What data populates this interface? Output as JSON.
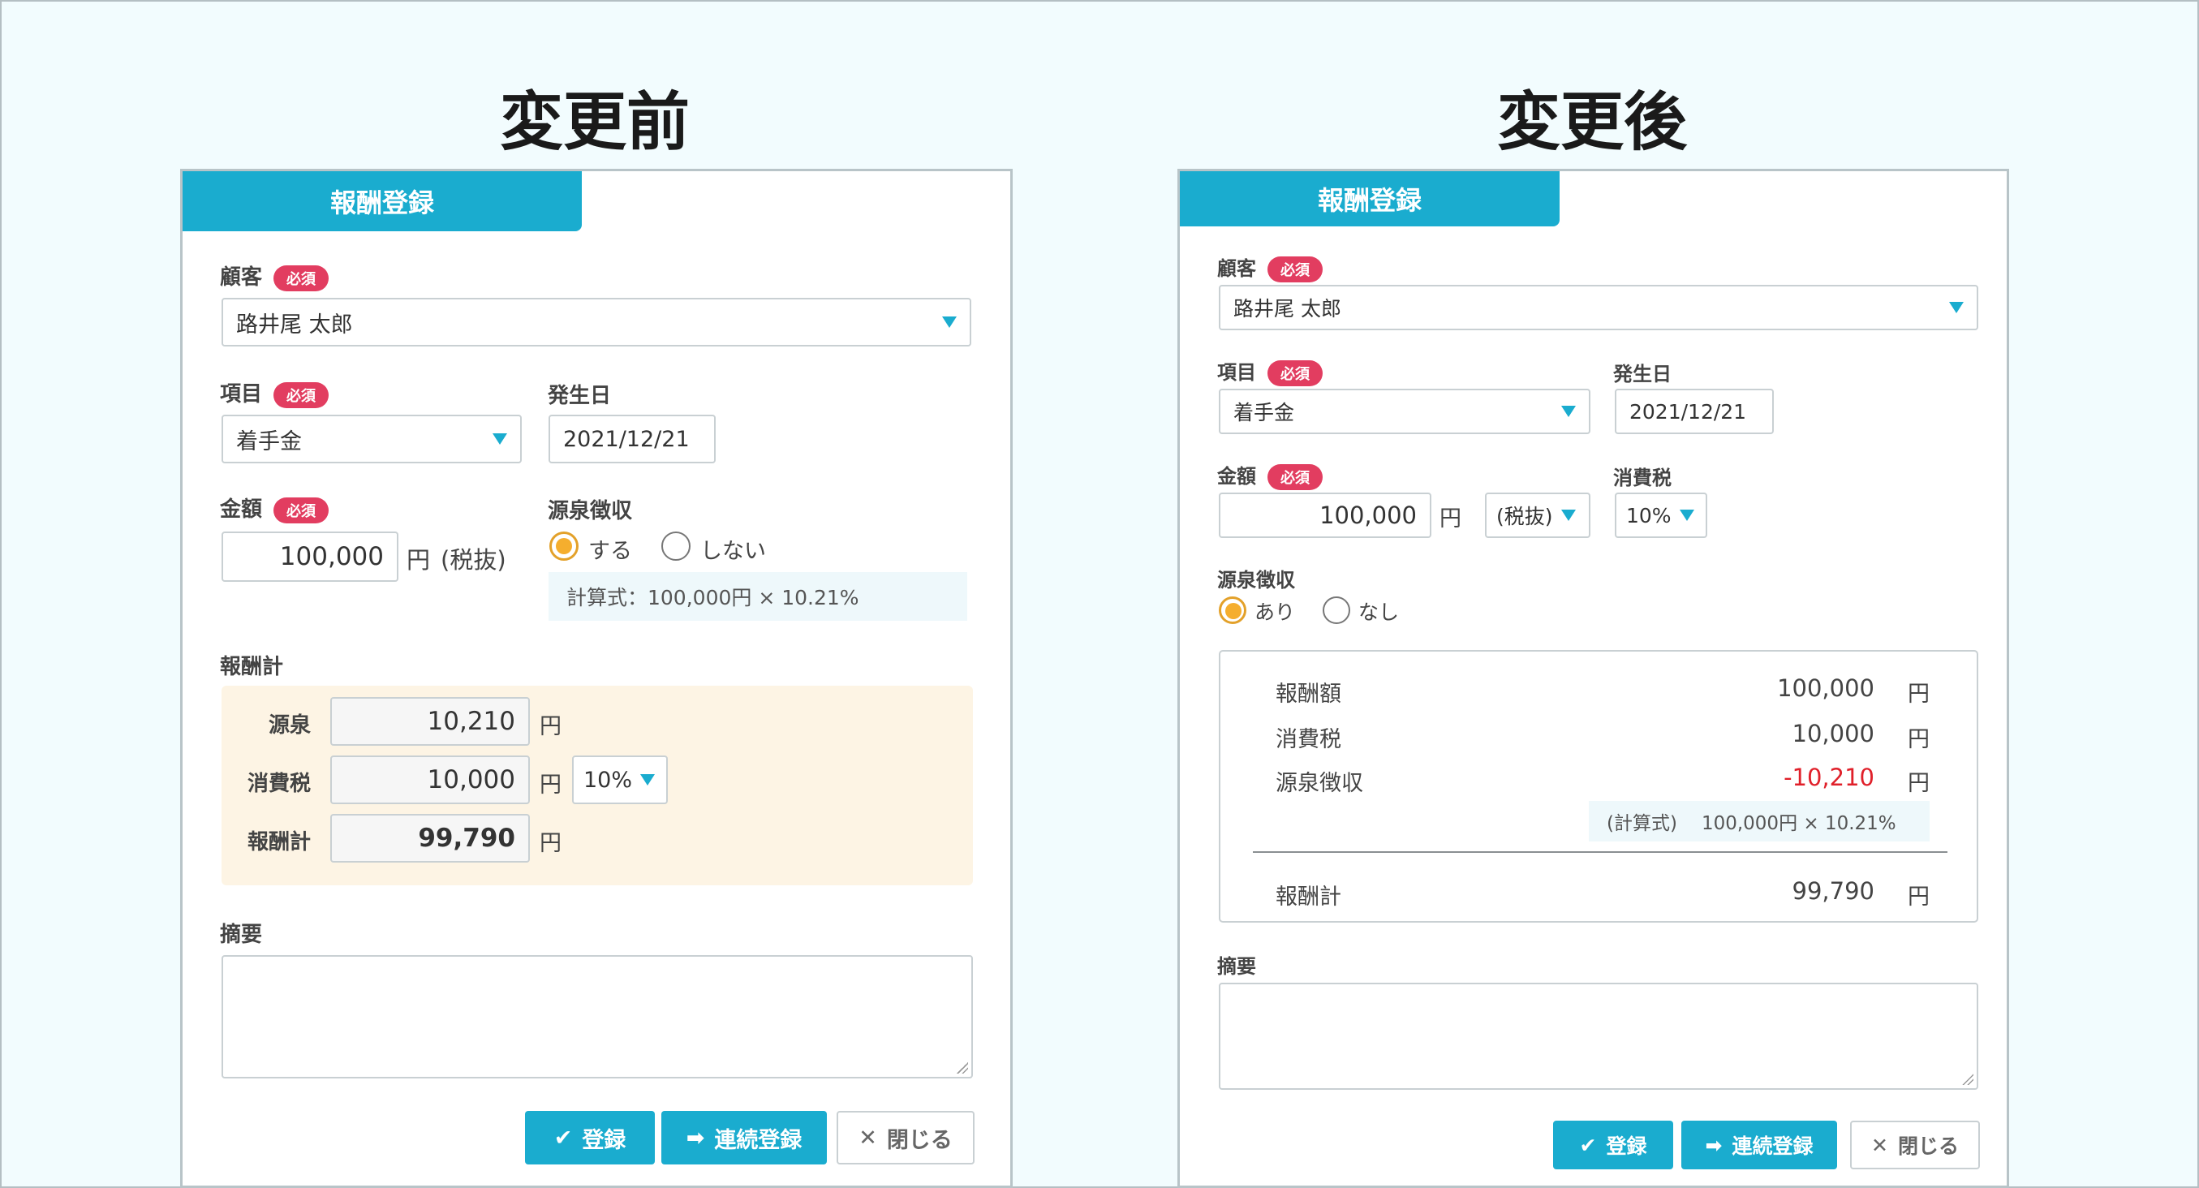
{
  "before": {
    "heading": "変更前",
    "tab_title": "報酬登録",
    "customer": {
      "label": "顧客",
      "required": "必須",
      "value": "路井尾 太郎"
    },
    "item": {
      "label": "項目",
      "required": "必須",
      "value": "着手金"
    },
    "date": {
      "label": "発生日",
      "value": "2021/12/21"
    },
    "amount": {
      "label": "金額",
      "required": "必須",
      "value": "100,000",
      "unit": "円",
      "tax_mode": "(税抜)"
    },
    "withholding": {
      "label": "源泉徴収",
      "options": [
        "する",
        "しない"
      ],
      "selected": "する",
      "formula": "計算式：100,000円 × 10.21%"
    },
    "fee_total": {
      "label": "報酬計",
      "rows": [
        {
          "label": "源泉",
          "value": "10,210",
          "unit": "円"
        },
        {
          "label": "消費税",
          "value": "10,000",
          "unit": "円",
          "rate": "10%"
        },
        {
          "label": "報酬計",
          "value": "99,790",
          "unit": "円"
        }
      ]
    },
    "memo": {
      "label": "摘要",
      "value": ""
    },
    "buttons": {
      "register": "登録",
      "continuous": "連続登録",
      "close": "閉じる"
    }
  },
  "after": {
    "heading": "変更後",
    "tab_title": "報酬登録",
    "customer": {
      "label": "顧客",
      "required": "必須",
      "value": "路井尾 太郎"
    },
    "item": {
      "label": "項目",
      "required": "必須",
      "value": "着手金"
    },
    "date": {
      "label": "発生日",
      "value": "2021/12/21"
    },
    "amount": {
      "label": "金額",
      "required": "必須",
      "value": "100,000",
      "unit": "円",
      "tax_mode": "(税抜)"
    },
    "tax": {
      "label": "消費税",
      "rate": "10%"
    },
    "withholding": {
      "label": "源泉徴収",
      "options": [
        "あり",
        "なし"
      ],
      "selected": "あり"
    },
    "summary": {
      "rows": [
        {
          "label": "報酬額",
          "value": "100,000",
          "unit": "円"
        },
        {
          "label": "消費税",
          "value": "10,000",
          "unit": "円"
        },
        {
          "label": "源泉徴収",
          "value": "-10,210",
          "unit": "円"
        }
      ],
      "formula_label": "(計算式)",
      "formula": "100,000円 × 10.21%",
      "total": {
        "label": "報酬計",
        "value": "99,790",
        "unit": "円"
      }
    },
    "memo": {
      "label": "摘要",
      "value": ""
    },
    "buttons": {
      "register": "登録",
      "continuous": "連続登録",
      "close": "閉じる"
    }
  },
  "colors": {
    "accent": "#1aaccf",
    "required": "#e23d60",
    "radio": "#f5ae2e",
    "negative": "#e0202a",
    "fee_bg": "#fdf4e4"
  }
}
